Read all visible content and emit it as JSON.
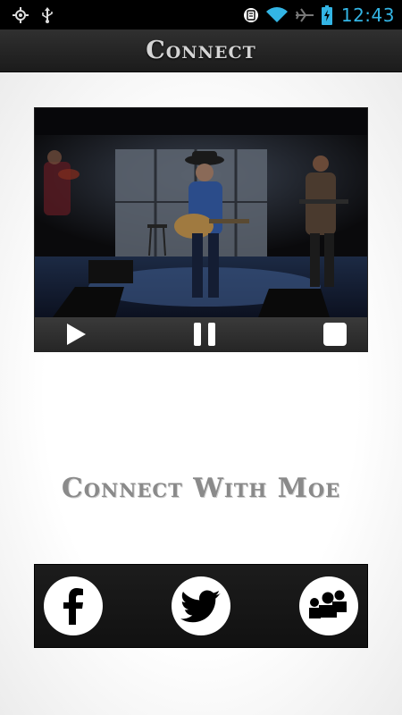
{
  "status_bar": {
    "time": "12:43",
    "icons": [
      "gps-icon",
      "usb-icon",
      "nfc-icon",
      "wifi-icon",
      "airplane-icon",
      "battery-charging-icon"
    ]
  },
  "header": {
    "title": "Connect"
  },
  "video": {
    "controls": [
      "play-icon",
      "pause-icon",
      "stop-icon"
    ]
  },
  "main": {
    "heading": "Connect With Moe"
  },
  "social": {
    "buttons": [
      "facebook-icon",
      "twitter-icon",
      "myspace-icon"
    ]
  },
  "colors": {
    "clock": "#33b5e5",
    "title_bar": "#1b1b1b",
    "heading": "#8a8a8a"
  }
}
